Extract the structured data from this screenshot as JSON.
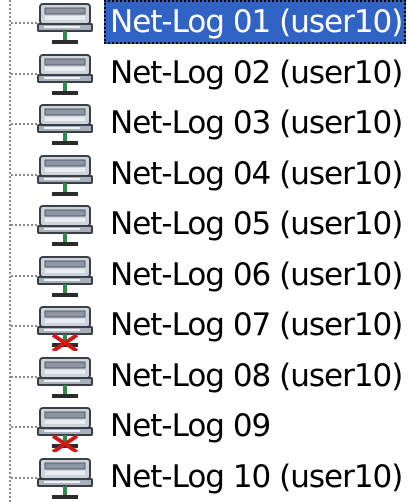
{
  "tree": {
    "items": [
      {
        "label": "Net-Log 01 (user10)",
        "selected": true,
        "status": "ok"
      },
      {
        "label": "Net-Log 02 (user10)",
        "selected": false,
        "status": "ok"
      },
      {
        "label": "Net-Log 03 (user10)",
        "selected": false,
        "status": "ok"
      },
      {
        "label": "Net-Log 04 (user10)",
        "selected": false,
        "status": "ok"
      },
      {
        "label": "Net-Log 05 (user10)",
        "selected": false,
        "status": "ok"
      },
      {
        "label": "Net-Log 06 (user10)",
        "selected": false,
        "status": "ok"
      },
      {
        "label": "Net-Log 07 (user10)",
        "selected": false,
        "status": "error"
      },
      {
        "label": "Net-Log 08 (user10)",
        "selected": false,
        "status": "ok"
      },
      {
        "label": "Net-Log 09",
        "selected": false,
        "status": "error"
      },
      {
        "label": "Net-Log 10 (user10)",
        "selected": false,
        "status": "ok"
      }
    ],
    "icon": "network-computer-icon",
    "colors": {
      "selection": "#3163c4",
      "error_mark": "#d01818",
      "connector": "#2e8a4a"
    }
  }
}
